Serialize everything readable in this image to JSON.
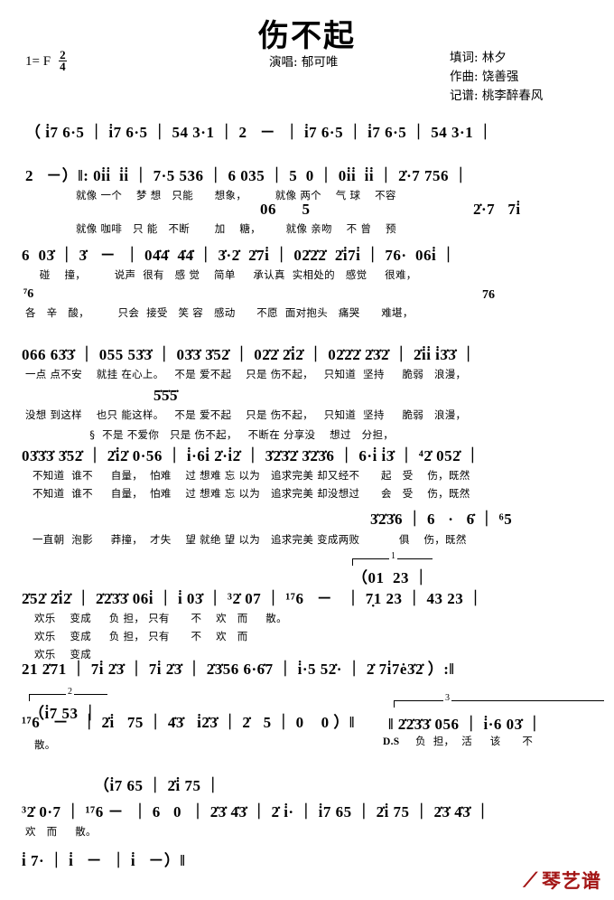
{
  "header": {
    "title": "伤不起",
    "key_label": "1= F",
    "time_num": "2",
    "time_den": "4",
    "singer": "演唱: 郁可唯",
    "lyricist": "填词: 林夕",
    "composer": "作曲: 饶善强",
    "transcriber": "记谱: 桃李醉春风"
  },
  "logo": {
    "mark": "⟋",
    "name": "琴艺谱",
    "color": "#a31515"
  },
  "chart_data": {
    "type": "table",
    "title": "伤不起 — 简谱 (Jianpu numbered notation)",
    "key": "1=F",
    "meter": "2/4",
    "lines": [
      {
        "id": "line-1",
        "notes": "（ i̇7 6·5 ｜ i̇7 6·5 ｜ 54 3·1 ｜ 2   －  ｜ i̇7 6·5 ｜ i̇7 6·5 ｜ 54 3·1 ｜",
        "lyrics": ""
      },
      {
        "id": "line-2",
        "notes": "2   －）‖: 0i̇i̇  i̇i̇ ｜ 7·5 536 ｜ 6 035 ｜ 5  0 ｜ 0i̇i̇  i̇i̇ ｜ 2̇·7 756 ｜",
        "lyrics": "就像 一个   梦 想  只能     想象，        就像 两个   气 球   不容",
        "alt_notes_above": "06    5            2̇·7  7i̇",
        "alt_lyrics": "就像 咖啡  只 能  不断     加   糖，     就像 亲吻   不 曾   预"
      },
      {
        "id": "line-3",
        "notes": "6  03̇ ｜ 3̇  －  ｜ 04̇4̇  4̇4̇ ｜ 3̇·2̇  2̇7i̇ ｜ 02̇2̇2̇  2̇i̇7i̇ ｜ 76·  06i̇ ｜",
        "lyrics": "   碰   撞，      说声 很有  感 觉   简单   承认真 实相处的  感觉    很难，",
        "alt_notes_above": "",
        "alt_lyrics": "各  辛  酸，      只会  接受  笑 容  感动    不愿 面对抱头  痛哭     难堪，",
        "alt_note_tail": "76",
        "pickup": "⁷6"
      },
      {
        "id": "line-4",
        "notes": "066 63̇3̇ ｜ 055 53̇3̇ ｜ 03̇3̇ 3̇52̇ ｜ 02̇2̇ 2̇i̇2̇ ｜ 02̇2̇2̇ 2̇3̇2̇ ｜ 2̇i̇i̇ i̇3̇3̇ ｜",
        "lyrics": "一点 点不安   就挂 在心上。  不是 爱不起   只是 伤不起，  只知道  坚持    脆弱   浪漫，",
        "alt_notes_above": "5̇5̇5̇",
        "alt_lyrics": "没想 到这样   也只 能这样。  不是 爱不起   只是 伤不起，  只知道  坚持    脆弱   浪漫，",
        "alt_lyrics_2": "§ 不是 不爱你   只是 伤不起，  不断在 分享没   想过   分担，"
      },
      {
        "id": "line-5",
        "notes": "03̇3̇3̇ 3̇52̇ ｜ 2̇i̇2̇ 0·56 ｜ i̇·6i̇ 2̇·i̇2̇ ｜ 3̇2̇3̇2̇ 3̇2̇3̇6 ｜ 6·i̇ i̇3̇ ｜ ⁴2̇ 052̇ ｜",
        "lyrics": "不知道  谁不    自量， 怕难   过 想难 忘 以为   追求完美 却又经不      起  受   伤，既然",
        "alt_lyrics": "不知道  谁不    自量， 怕难   过 想难 忘 以为   追求完美 却没想过      会  受   伤，既然",
        "alt_lyrics_2": "一直朝  泡影    莽撞， 才失   望 就绝 望 以为   追求完美 变成两败          俱   伤，既然",
        "alt_notes_above": "3̇2̇3̇6 ｜ 6  ·  6̇ ｜ ⁶5"
      },
      {
        "id": "line-6-bracket",
        "bracket": "1",
        "notes": "（01  23 ｜"
      },
      {
        "id": "line-6",
        "notes": "2̇52̇ 2̇i̇2̇ ｜ 2̇2̇3̇3̇ 06i̇ ｜ i̇ 03̇ ｜ ³2̇ 07 ｜ ¹⁷6  －  ｜ 7̣1 23 ｜ 43 23 ｜",
        "lyrics": "欢乐   变成    负 担， 只有    不   欢  而    散。",
        "alt_lyrics": "欢乐   变成    负 担， 只有    不   欢  而",
        "alt_lyrics_2": "欢乐   变成"
      },
      {
        "id": "line-7",
        "notes": "21 2̇71 ｜ 7i̇ 2̇3̇ ｜ 7i̇ 2̇3̇ ｜ 2̇3̇56 6·6̇7 ｜ i̇·5 52̇· ｜ 2̇ 7i̇7ė3̇2̇ ）:‖",
        "lyrics": ""
      },
      {
        "id": "line-8-bracket",
        "bracket": "2",
        "notes": "（i̇7 53 ｜"
      },
      {
        "id": "line-8",
        "notes": "¹⁷6  －  ｜ 2̇i̇  75 ｜ 4̇3̇  i̇2̇3̇ ｜ 2̇  5 ｜ 0   0）‖",
        "lyrics": "散。",
        "coda_bracket": "3",
        "coda_notes": "‖ 2̇2̇3̇3̇ 056 ｜ i̇·6 03̇ ｜",
        "coda_mark": "D.S",
        "coda_lyrics": "负  担， 活    该     不"
      },
      {
        "id": "line-9",
        "notes": "³2̇ 0·7 ｜ ¹⁷6 － ｜ 6  0 ｜ 2̇3̇ 4̇3̇ ｜ 2̇ i̇· ｜ i̇7 65 ｜ 2̇i̇ 75 ｜ 2̇3̇ 4̇3̇ ｜",
        "lyrics": "欢  而    散。",
        "alt_notes_above": "（i̇7 65 ｜ 2̇i̇ 75 ｜"
      },
      {
        "id": "line-10",
        "notes": "i̇ 7· ｜ i̇  －  ｜ i̇  －）‖",
        "lyrics": ""
      }
    ]
  },
  "music": {
    "l1_notes": "（ i̇7 6·5 ｜ i̇7 6·5 ｜ 54 3·1 ｜ 2   －  ｜ i̇7 6·5 ｜ i̇7 6·5 ｜ 54 3·1 ｜",
    "l2_notes": "2   －）‖: 0i̇i̇  i̇i̇ ｜ 7·5 536 ｜ 6 035 ｜ 5  0 ｜ 0i̇i̇  i̇i̇ ｜ 2̇·7 756 ｜",
    "l2_lyrics": "就像 一个    梦 想   只能      想象，        就像 两个    气 球    不容",
    "l2b_notes": "06      5                                      2̇·7   7i̇",
    "l2b_lyrics": "就像 咖啡   只 能   不断       加    糖，       就像 亲吻    不 曾    预",
    "l3_notes": "6  03̇ ｜ 3̇   －  ｜ 04̇4̇  4̇4̇ ｜ 3̇·2̇  2̇7i̇ ｜ 02̇2̇2̇  2̇i̇7i̇ ｜ 76·  06i̇ ｜",
    "l3_lyrics": "    碰    撞，        说声  很有   感 觉    简单     承认真  实相处的   感觉     很难，",
    "l3b_pickup": "⁷6",
    "l3b_tail": "76",
    "l3b_lyrics": "各   辛   酸，        只会  接受   笑 容   感动      不愿  面对抱头   痛哭      难堪，",
    "l4_notes": "066 63̇3̇ ｜ 055 53̇3̇ ｜ 03̇3̇ 3̇52̇ ｜ 02̇2̇ 2̇i̇2̇ ｜ 02̇2̇2̇ 2̇3̇2̇ ｜ 2̇i̇i̇ i̇3̇3̇ ｜",
    "l4_lyrics": "一点 点不安    就挂 在心上。   不是 爱不起    只是 伤不起，   只知道  坚持     脆弱   浪漫，",
    "l4b_notes": "5̇5̇5̇",
    "l4b_lyrics": "没想 到这样    也只 能这样。   不是 爱不起    只是 伤不起，   只知道  坚持     脆弱   浪漫，",
    "l4c_lyrics": "                  §  不是 不爱你   只是 伤不起，   不断在 分享没    想过   分担，",
    "l5_notes": "03̇3̇3̇ 3̇52̇ ｜ 2̇i̇2̇ 0·56 ｜ i̇·6i̇ 2̇·i̇2̇ ｜ 3̇2̇3̇2̇ 3̇2̇3̇6 ｜ 6·i̇ i̇3̇ ｜ ⁴2̇ 052̇ ｜",
    "l5_lyrics": "不知道  谁不     自量，  怕难    过 想难 忘 以为   追求完美 却又经不      起   受    伤，既然",
    "l5b_lyrics": "不知道  谁不     自量，  怕难    过 想难 忘 以为   追求完美 却没想过      会   受    伤，既然",
    "l5c_notes": "3̇2̇3̇6 ｜ 6   ·   6̇ ｜ ⁶5",
    "l5c_lyrics": "一直朝  泡影     莽撞，  才失    望 就绝 望 以为   追求完美 变成两败           俱    伤，既然",
    "ending1_num": "1",
    "ending1_notes": "（01  23 ｜",
    "l6_notes": "2̇52̇ 2̇i̇2̇ ｜ 2̇2̇3̇3̇ 06i̇ ｜ i̇ 03̇ ｜ ³2̇ 07 ｜ ¹⁷6   －   ｜ 7̣1 23 ｜ 43 23 ｜",
    "l6_lyrics": "欢乐    变成     负 担， 只有      不    欢   而     散。",
    "l6b_lyrics": "欢乐    变成     负 担， 只有      不    欢   而",
    "l6c_lyrics": "欢乐    变成",
    "l7_notes": "21 2̇71 ｜ 7i̇ 2̇3̇ ｜ 7i̇ 2̇3̇ ｜ 2̇3̇56 6·6̇7 ｜ i̇·5 52̇· ｜ 2̇ 7i̇7ė3̇2̇ ）:‖",
    "ending2_num": "2",
    "ending2_notes": "（i̇7 53 ｜",
    "l8_notes": "¹⁷6   －   ｜ 2̇i̇   75 ｜ 4̇3̇   i̇2̇3̇ ｜ 2̇   5 ｜ 0    0 ）‖",
    "l8_lyrics": "散。",
    "ending3_num": "3",
    "l8_coda_notes": "‖ 2̇2̇3̇3̇ 056 ｜ i̇·6 03̇ ｜",
    "l8_coda_mark": "D.S",
    "l8_coda_lyrics": "负  担，  活     该      不",
    "l9_above": "（i̇7 65 ｜ 2̇i̇ 75 ｜",
    "l9_notes": "³2̇ 0·7 ｜ ¹⁷6 －  ｜ 6   0  ｜ 2̇3̇ 4̇3̇ ｜ 2̇ i̇· ｜ i̇7 65 ｜ 2̇i̇ 75 ｜ 2̇3̇ 4̇3̇ ｜",
    "l9_lyrics": "欢   而     散。",
    "l10_notes": "i̇ 7· ｜ i̇   －  ｜ i̇   －）‖"
  }
}
